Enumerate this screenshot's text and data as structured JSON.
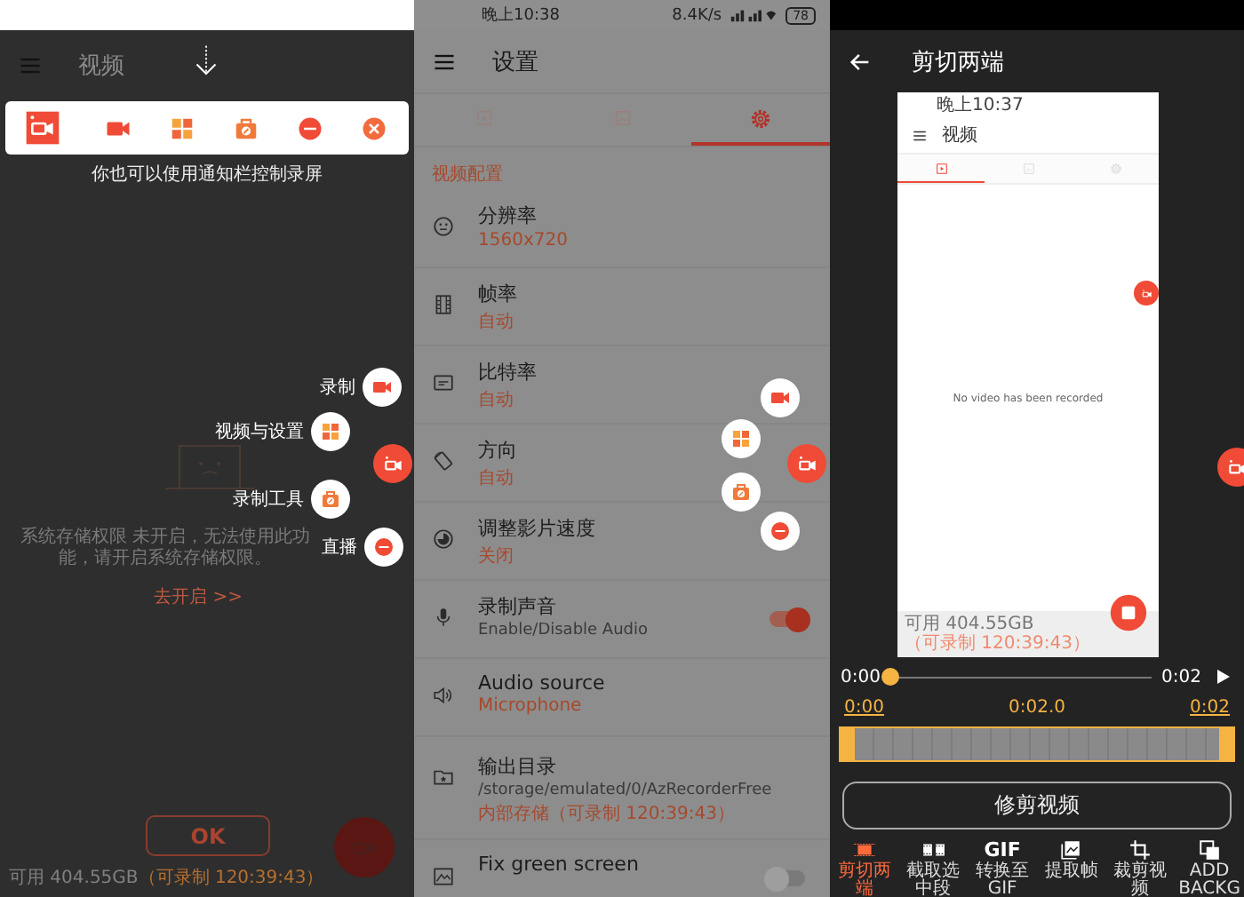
{
  "recording_screen": {
    "title": "视频",
    "notification_buttons": [
      {
        "kind": "app"
      },
      {
        "kind": "record"
      },
      {
        "kind": "grid"
      },
      {
        "kind": "toolbox"
      },
      {
        "kind": "live"
      },
      {
        "kind": "close"
      }
    ],
    "hint": "你也可以使用通知栏控制录屏",
    "empty_message": "系统存储权限 未开启，无法使用此功能，请开启系统存储权限。",
    "enable_link": "去开启 >>",
    "float_menu": [
      {
        "label": "录制",
        "kind": "record"
      },
      {
        "label": "视频与设置",
        "kind": "grid"
      },
      {
        "label": "录制工具",
        "kind": "toolbox"
      },
      {
        "label": "直播",
        "kind": "live"
      }
    ],
    "ok_button": "OK",
    "storage": "可用 404.55GB",
    "recordable": "（可录制 120:39:43）"
  },
  "settings_screen": {
    "status_bar": {
      "time": "晚上10:38",
      "speed": "8.4K/s",
      "battery": "78"
    },
    "title": "设置",
    "tabs": [
      {
        "kind": "video",
        "selected": false
      },
      {
        "kind": "image",
        "selected": false
      },
      {
        "kind": "settings",
        "selected": true
      }
    ],
    "section": "视频配置",
    "items": [
      {
        "kind": "value",
        "title": "分辨率",
        "value": "1560x720"
      },
      {
        "kind": "value",
        "title": "帧率",
        "value": "自动"
      },
      {
        "kind": "value",
        "title": "比特率",
        "value": "自动"
      },
      {
        "kind": "value",
        "title": "方向",
        "value": "自动"
      },
      {
        "kind": "value",
        "title": "调整影片速度",
        "value": "关闭"
      },
      {
        "kind": "toggle",
        "title": "录制声音",
        "description": "Enable/Disable Audio",
        "on": true
      },
      {
        "kind": "value",
        "title": "Audio source",
        "value": "Microphone"
      },
      {
        "kind": "path",
        "title": "输出目录",
        "description": "/storage/emulated/0/AzRecorderFree",
        "value": "内部存储（可录制 120:39:43）"
      },
      {
        "kind": "toggle",
        "title": "Fix green screen",
        "on": false
      }
    ],
    "float_buttons": [
      {
        "kind": "record"
      },
      {
        "kind": "grid"
      },
      {
        "kind": "app"
      },
      {
        "kind": "toolbox"
      },
      {
        "kind": "live"
      }
    ]
  },
  "trim_screen": {
    "title": "剪切两端",
    "preview": {
      "time": "晚上10:37",
      "title": "视频",
      "tabs": [
        {
          "kind": "video",
          "selected": true
        },
        {
          "kind": "image",
          "selected": false
        },
        {
          "kind": "settings",
          "selected": false
        }
      ],
      "message": "No video has been recorded",
      "storage": "可用 404.55GB",
      "recordable": "（可录制 120:39:43）"
    },
    "player": {
      "position": "0:00",
      "duration": "0:02",
      "level": 0
    },
    "timeline": {
      "start": "0:00",
      "middle": "0:02.0",
      "end": "0:02"
    },
    "trim_button": "修剪视频",
    "tools": [
      {
        "kind": "trim",
        "label": "剪切两端",
        "selected": true
      },
      {
        "kind": "cut",
        "label": "截取选中段",
        "selected": false
      },
      {
        "kind": "gif",
        "glyph": "GIF",
        "label": "转换至GIF",
        "selected": false
      },
      {
        "kind": "frames",
        "label": "提取帧",
        "selected": false
      },
      {
        "kind": "crop",
        "label": "裁剪视频",
        "selected": false
      },
      {
        "kind": "background",
        "label": "ADD BACKG",
        "selected": false
      }
    ]
  }
}
